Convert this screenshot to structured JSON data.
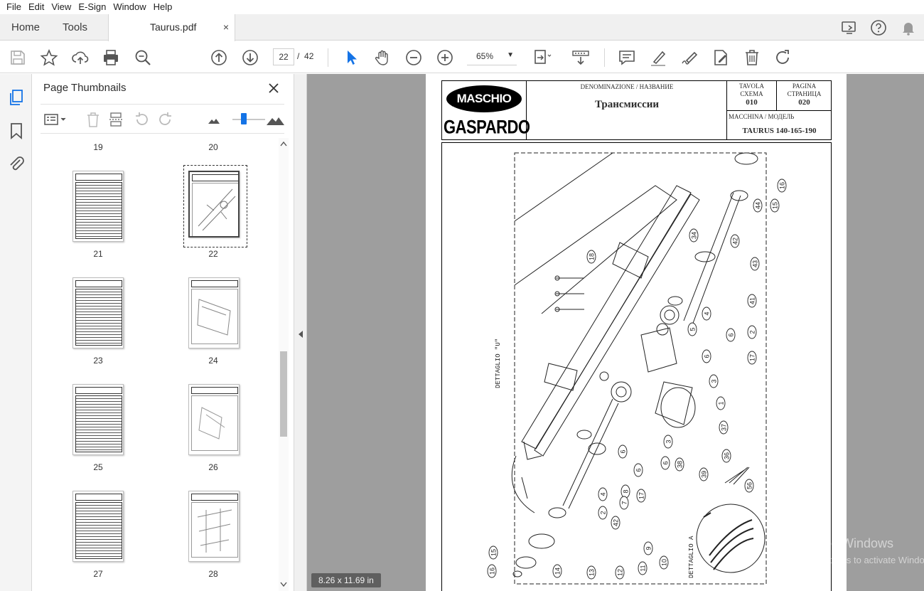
{
  "menu": [
    "File",
    "Edit",
    "View",
    "E-Sign",
    "Window",
    "Help"
  ],
  "tabs": {
    "home": "Home",
    "tools": "Tools",
    "document": "Taurus.pdf",
    "close": "×"
  },
  "toolbar": {
    "current_page": "22",
    "page_separator": "/",
    "total_pages": "42",
    "zoom": "65%"
  },
  "thumbnails": {
    "title": "Page Thumbnails",
    "pages": [
      {
        "label": "19",
        "kind": ""
      },
      {
        "label": "20",
        "kind": ""
      },
      {
        "label": "21",
        "kind": "table"
      },
      {
        "label": "22",
        "kind": "drawing",
        "selected": true
      },
      {
        "label": "23",
        "kind": "table"
      },
      {
        "label": "24",
        "kind": "drawing"
      },
      {
        "label": "25",
        "kind": "table"
      },
      {
        "label": "26",
        "kind": "drawing"
      },
      {
        "label": "27",
        "kind": "table"
      },
      {
        "label": "28",
        "kind": "drawing"
      }
    ]
  },
  "document": {
    "logo_top": "MASCHIO",
    "logo_bottom": "GASPARDO",
    "denomination_label": "DENOMINAZIONE / НАЗВАНИЕ",
    "denomination_title": "Трансмиссии",
    "tavola_label_1": "TAVOLA",
    "tavola_label_2": "СХЕМА",
    "tavola_value": "010",
    "pagina_label_1": "PAGINA",
    "pagina_label_2": "СТРАНИЦА",
    "pagina_value": "020",
    "model_label": "MACCHINA / МОДЕЛЬ",
    "model_value": "TAURUS 140-165-190",
    "detail_u": "DETTAGLIO \"U\"",
    "detail_a": "DETTAGLIO A",
    "callouts": [
      "16",
      "15",
      "44",
      "42",
      "43",
      "34",
      "18",
      "41",
      "2",
      "4",
      "5",
      "6",
      "17",
      "6",
      "3",
      "1",
      "37",
      "36",
      "39",
      "38",
      "6",
      "3",
      "6",
      "6",
      "17",
      "8",
      "4",
      "2",
      "7",
      "42",
      "9",
      "10",
      "11",
      "12",
      "13",
      "14",
      "15",
      "16",
      "56"
    ]
  },
  "status": {
    "page_size": "8.26 x 11.69 in"
  },
  "watermark": {
    "line1": "Activate Windows",
    "line2": "Go to Settings to activate Windows."
  },
  "colors": {
    "accent": "#1473e6",
    "canvas": "#9e9e9e",
    "tab_bar": "#f0f0f0"
  }
}
